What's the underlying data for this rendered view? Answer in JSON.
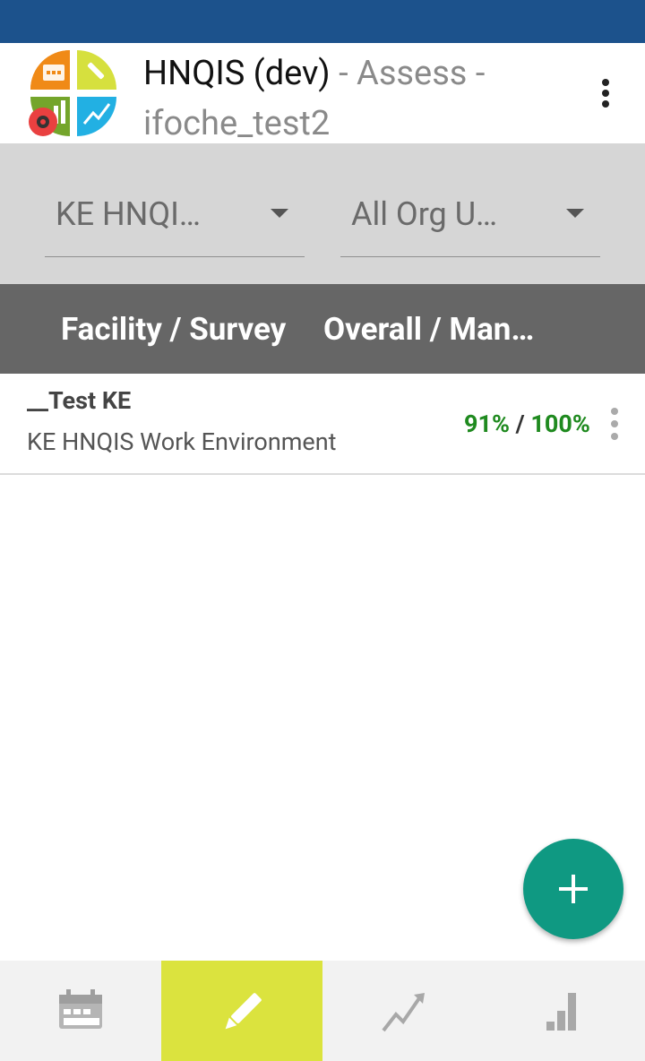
{
  "app_bar": {
    "title": "HNQIS (dev)",
    "subtitle_mode": " - Assess - ",
    "username": "ifoche_test2",
    "menu_icon": "overflow-menu-icon"
  },
  "filters": {
    "program": "KE HNQI…",
    "org_unit": "All Org U…"
  },
  "table_header": {
    "col_facility": "Facility / Survey",
    "col_overall": "Overall / Man…"
  },
  "surveys": [
    {
      "facility": "__Test KE",
      "program": "KE HNQIS Work Environment",
      "overall_score": "91%",
      "separator": " / ",
      "mandatory_score": "100%"
    }
  ],
  "fab": {
    "icon": "add-icon"
  },
  "bottom_nav": {
    "tabs": [
      {
        "icon": "calendar-icon",
        "active": false
      },
      {
        "icon": "pencil-icon",
        "active": true
      },
      {
        "icon": "trend-chart-icon",
        "active": false
      },
      {
        "icon": "bar-chart-icon",
        "active": false
      }
    ]
  },
  "colors": {
    "status_bar": "#1c528c",
    "score_green": "#1f8a1f",
    "fab": "#0f9982",
    "active_tab": "#dbe33e"
  }
}
